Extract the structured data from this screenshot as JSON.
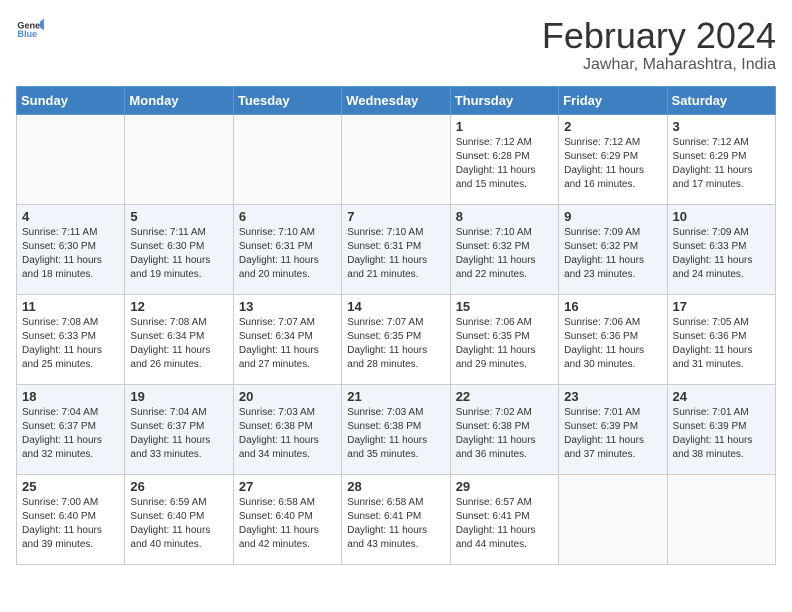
{
  "header": {
    "logo_general": "General",
    "logo_blue": "Blue",
    "main_title": "February 2024",
    "subtitle": "Jawhar, Maharashtra, India"
  },
  "calendar": {
    "days_of_week": [
      "Sunday",
      "Monday",
      "Tuesday",
      "Wednesday",
      "Thursday",
      "Friday",
      "Saturday"
    ],
    "weeks": [
      [
        {
          "day": "",
          "info": ""
        },
        {
          "day": "",
          "info": ""
        },
        {
          "day": "",
          "info": ""
        },
        {
          "day": "",
          "info": ""
        },
        {
          "day": "1",
          "info": "Sunrise: 7:12 AM\nSunset: 6:28 PM\nDaylight: 11 hours and 15 minutes."
        },
        {
          "day": "2",
          "info": "Sunrise: 7:12 AM\nSunset: 6:29 PM\nDaylight: 11 hours and 16 minutes."
        },
        {
          "day": "3",
          "info": "Sunrise: 7:12 AM\nSunset: 6:29 PM\nDaylight: 11 hours and 17 minutes."
        }
      ],
      [
        {
          "day": "4",
          "info": "Sunrise: 7:11 AM\nSunset: 6:30 PM\nDaylight: 11 hours and 18 minutes."
        },
        {
          "day": "5",
          "info": "Sunrise: 7:11 AM\nSunset: 6:30 PM\nDaylight: 11 hours and 19 minutes."
        },
        {
          "day": "6",
          "info": "Sunrise: 7:10 AM\nSunset: 6:31 PM\nDaylight: 11 hours and 20 minutes."
        },
        {
          "day": "7",
          "info": "Sunrise: 7:10 AM\nSunset: 6:31 PM\nDaylight: 11 hours and 21 minutes."
        },
        {
          "day": "8",
          "info": "Sunrise: 7:10 AM\nSunset: 6:32 PM\nDaylight: 11 hours and 22 minutes."
        },
        {
          "day": "9",
          "info": "Sunrise: 7:09 AM\nSunset: 6:32 PM\nDaylight: 11 hours and 23 minutes."
        },
        {
          "day": "10",
          "info": "Sunrise: 7:09 AM\nSunset: 6:33 PM\nDaylight: 11 hours and 24 minutes."
        }
      ],
      [
        {
          "day": "11",
          "info": "Sunrise: 7:08 AM\nSunset: 6:33 PM\nDaylight: 11 hours and 25 minutes."
        },
        {
          "day": "12",
          "info": "Sunrise: 7:08 AM\nSunset: 6:34 PM\nDaylight: 11 hours and 26 minutes."
        },
        {
          "day": "13",
          "info": "Sunrise: 7:07 AM\nSunset: 6:34 PM\nDaylight: 11 hours and 27 minutes."
        },
        {
          "day": "14",
          "info": "Sunrise: 7:07 AM\nSunset: 6:35 PM\nDaylight: 11 hours and 28 minutes."
        },
        {
          "day": "15",
          "info": "Sunrise: 7:06 AM\nSunset: 6:35 PM\nDaylight: 11 hours and 29 minutes."
        },
        {
          "day": "16",
          "info": "Sunrise: 7:06 AM\nSunset: 6:36 PM\nDaylight: 11 hours and 30 minutes."
        },
        {
          "day": "17",
          "info": "Sunrise: 7:05 AM\nSunset: 6:36 PM\nDaylight: 11 hours and 31 minutes."
        }
      ],
      [
        {
          "day": "18",
          "info": "Sunrise: 7:04 AM\nSunset: 6:37 PM\nDaylight: 11 hours and 32 minutes."
        },
        {
          "day": "19",
          "info": "Sunrise: 7:04 AM\nSunset: 6:37 PM\nDaylight: 11 hours and 33 minutes."
        },
        {
          "day": "20",
          "info": "Sunrise: 7:03 AM\nSunset: 6:38 PM\nDaylight: 11 hours and 34 minutes."
        },
        {
          "day": "21",
          "info": "Sunrise: 7:03 AM\nSunset: 6:38 PM\nDaylight: 11 hours and 35 minutes."
        },
        {
          "day": "22",
          "info": "Sunrise: 7:02 AM\nSunset: 6:38 PM\nDaylight: 11 hours and 36 minutes."
        },
        {
          "day": "23",
          "info": "Sunrise: 7:01 AM\nSunset: 6:39 PM\nDaylight: 11 hours and 37 minutes."
        },
        {
          "day": "24",
          "info": "Sunrise: 7:01 AM\nSunset: 6:39 PM\nDaylight: 11 hours and 38 minutes."
        }
      ],
      [
        {
          "day": "25",
          "info": "Sunrise: 7:00 AM\nSunset: 6:40 PM\nDaylight: 11 hours and 39 minutes."
        },
        {
          "day": "26",
          "info": "Sunrise: 6:59 AM\nSunset: 6:40 PM\nDaylight: 11 hours and 40 minutes."
        },
        {
          "day": "27",
          "info": "Sunrise: 6:58 AM\nSunset: 6:40 PM\nDaylight: 11 hours and 42 minutes."
        },
        {
          "day": "28",
          "info": "Sunrise: 6:58 AM\nSunset: 6:41 PM\nDaylight: 11 hours and 43 minutes."
        },
        {
          "day": "29",
          "info": "Sunrise: 6:57 AM\nSunset: 6:41 PM\nDaylight: 11 hours and 44 minutes."
        },
        {
          "day": "",
          "info": ""
        },
        {
          "day": "",
          "info": ""
        }
      ]
    ]
  }
}
